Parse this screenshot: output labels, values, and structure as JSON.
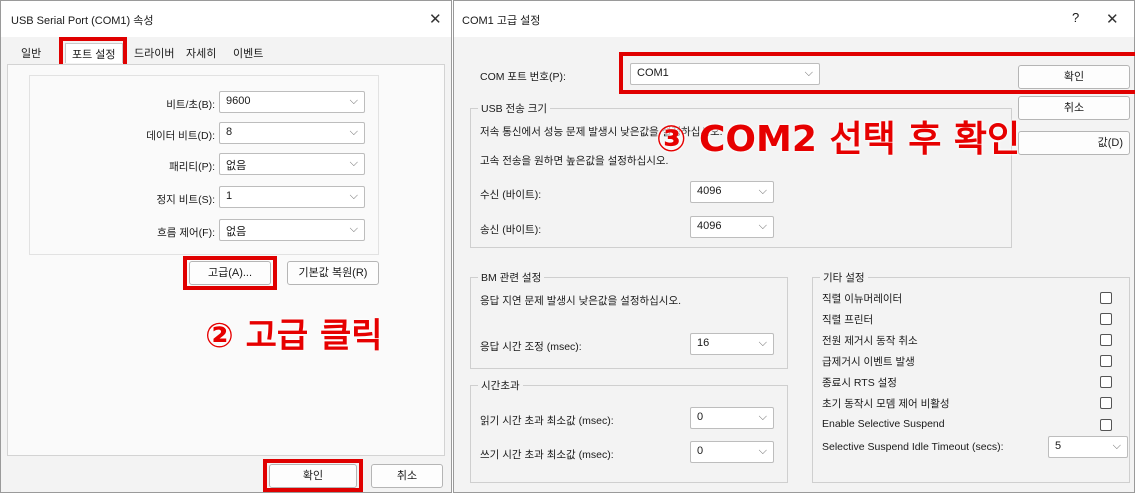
{
  "left_dialog": {
    "title": "USB Serial Port (COM1) 속성",
    "tabs": [
      "일반",
      "포트 설정",
      "드라이버",
      "자세히",
      "이벤트"
    ],
    "fields": [
      {
        "label": "비트/초(B):",
        "value": "9600"
      },
      {
        "label": "데이터 비트(D):",
        "value": "8"
      },
      {
        "label": "패리티(P):",
        "value": "없음"
      },
      {
        "label": "정지 비트(S):",
        "value": "1"
      },
      {
        "label": "흐름 제어(F):",
        "value": "없음"
      }
    ],
    "advanced_button": "고급(A)...",
    "restore_button": "기본값 복원(R)",
    "ok_button": "확인",
    "cancel_button": "취소"
  },
  "right_dialog": {
    "title": "COM1 고급 설정",
    "help": "?",
    "com_port_label": "COM 포트 번호(P):",
    "com_port_value": "COM1",
    "ok_button": "확인",
    "cancel_button": "취소",
    "default_button_partial": "값(D)",
    "usb": {
      "legend": "USB 전송 크기",
      "desc1": "저속 통신에서 성능 문제 발생시 낮은값을 설정하십시오.",
      "desc2": "고속 전송을 원하면 높은값을 설정하십시오.",
      "rx_label": "수신 (바이트):",
      "rx_value": "4096",
      "tx_label": "송신 (바이트):",
      "tx_value": "4096"
    },
    "bm": {
      "legend": "BM 관련 설정",
      "desc": "응답 지연 문제 발생시 낮은값을 설정하십시오.",
      "latency_label": "응답 시간 조정 (msec):",
      "latency_value": "16"
    },
    "timeout": {
      "legend": "시간초과",
      "read_label": "읽기 시간 초과 최소값 (msec):",
      "read_value": "0",
      "write_label": "쓰기 시간 초과 최소값 (msec):",
      "write_value": "0"
    },
    "misc": {
      "legend": "기타 설정",
      "options": [
        "직렬 이뉴머레이터",
        "직렬 프린터",
        "전원 제거시 동작 취소",
        "급제거시 이벤트 발생",
        "종료시 RTS 설정",
        "초기 동작시 모뎀 제어 비활성",
        "Enable Selective Suspend"
      ],
      "suspend_label": "Selective Suspend Idle Timeout (secs):",
      "suspend_value": "5"
    }
  },
  "annotations": {
    "step2": "② 고급 클릭",
    "step3": "③ COM2 선택 후 확인"
  },
  "colors": {
    "annotation_red": "#e60000"
  }
}
